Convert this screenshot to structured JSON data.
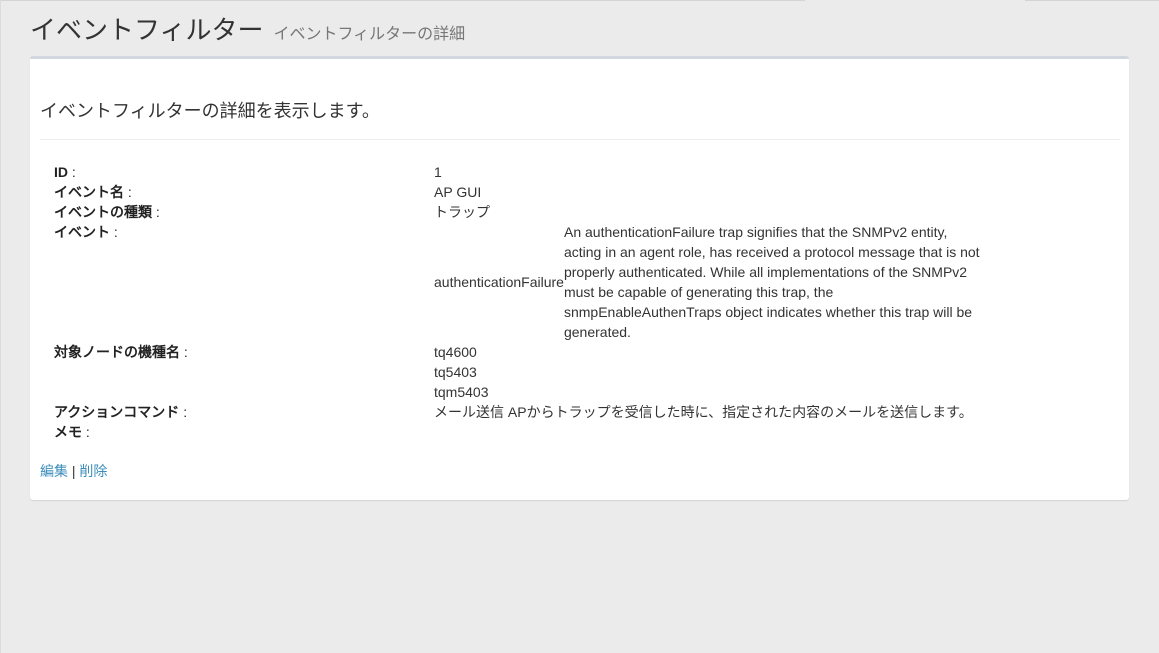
{
  "header": {
    "title": "イベントフィルター",
    "subtitle": "イベントフィルターの詳細"
  },
  "panel": {
    "lead": "イベントフィルターの詳細を表示します。"
  },
  "details": {
    "id": {
      "label": "ID",
      "colon": " :",
      "value": "1"
    },
    "event_name": {
      "label": "イベント名",
      "colon": " :",
      "value": "AP GUI"
    },
    "event_type": {
      "label": "イベントの種類",
      "colon": " :",
      "value": "トラップ"
    },
    "event": {
      "label": "イベント",
      "colon": " :",
      "name": "authenticationFailure",
      "description": "An authenticationFailure trap signifies that the SNMPv2 entity, acting in an agent role, has received a protocol message that is not properly authenticated. While all implementations of the SNMPv2 must be capable of generating this trap, the snmpEnableAuthenTraps object indicates whether this trap will be generated."
    },
    "target_nodes": {
      "label": "対象ノードの機種名",
      "colon": " :",
      "values": [
        "tq4600",
        "tq5403",
        "tqm5403"
      ]
    },
    "action_command": {
      "label": "アクションコマンド",
      "colon": " :",
      "value": "メール送信 APからトラップを受信した時に、指定された内容のメールを送信します。"
    },
    "memo": {
      "label": "メモ",
      "colon": " :",
      "value": ""
    }
  },
  "actions": {
    "edit_label": "編集",
    "separator": " | ",
    "delete_label": "削除"
  },
  "colors": {
    "background": "#ebebeb",
    "panel": "#ffffff",
    "link": "#3c8dbc",
    "panel_border": "#d2d6de"
  }
}
